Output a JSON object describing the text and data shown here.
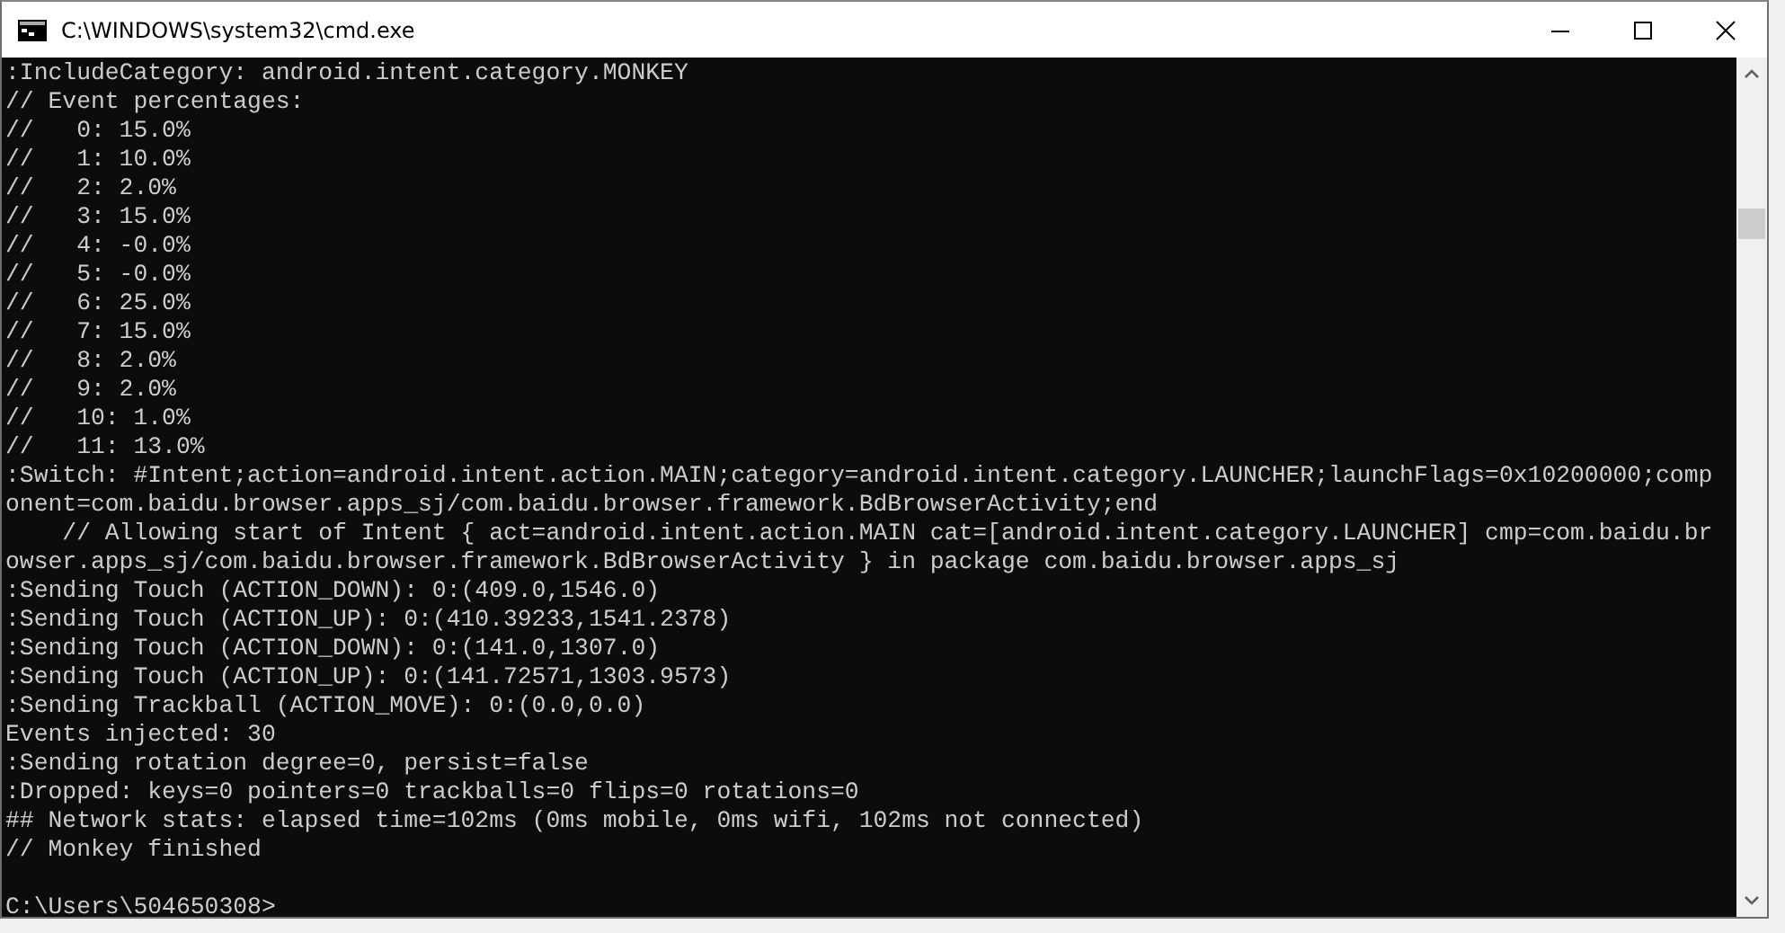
{
  "window": {
    "title": "C:\\WINDOWS\\system32\\cmd.exe"
  },
  "console": {
    "lines": [
      ":IncludeCategory: android.intent.category.MONKEY",
      "// Event percentages:",
      "//   0: 15.0%",
      "//   1: 10.0%",
      "//   2: 2.0%",
      "//   3: 15.0%",
      "//   4: -0.0%",
      "//   5: -0.0%",
      "//   6: 25.0%",
      "//   7: 15.0%",
      "//   8: 2.0%",
      "//   9: 2.0%",
      "//   10: 1.0%",
      "//   11: 13.0%",
      ":Switch: #Intent;action=android.intent.action.MAIN;category=android.intent.category.LAUNCHER;launchFlags=0x10200000;comp",
      "onent=com.baidu.browser.apps_sj/com.baidu.browser.framework.BdBrowserActivity;end",
      "    // Allowing start of Intent { act=android.intent.action.MAIN cat=[android.intent.category.LAUNCHER] cmp=com.baidu.br",
      "owser.apps_sj/com.baidu.browser.framework.BdBrowserActivity } in package com.baidu.browser.apps_sj",
      ":Sending Touch (ACTION_DOWN): 0:(409.0,1546.0)",
      ":Sending Touch (ACTION_UP): 0:(410.39233,1541.2378)",
      ":Sending Touch (ACTION_DOWN): 0:(141.0,1307.0)",
      ":Sending Touch (ACTION_UP): 0:(141.72571,1303.9573)",
      ":Sending Trackball (ACTION_MOVE): 0:(0.0,0.0)",
      "Events injected: 30",
      ":Sending rotation degree=0, persist=false",
      ":Dropped: keys=0 pointers=0 trackballs=0 flips=0 rotations=0",
      "## Network stats: elapsed time=102ms (0ms mobile, 0ms wifi, 102ms not connected)",
      "// Monkey finished"
    ],
    "prompt": "C:\\Users\\504650308>"
  }
}
